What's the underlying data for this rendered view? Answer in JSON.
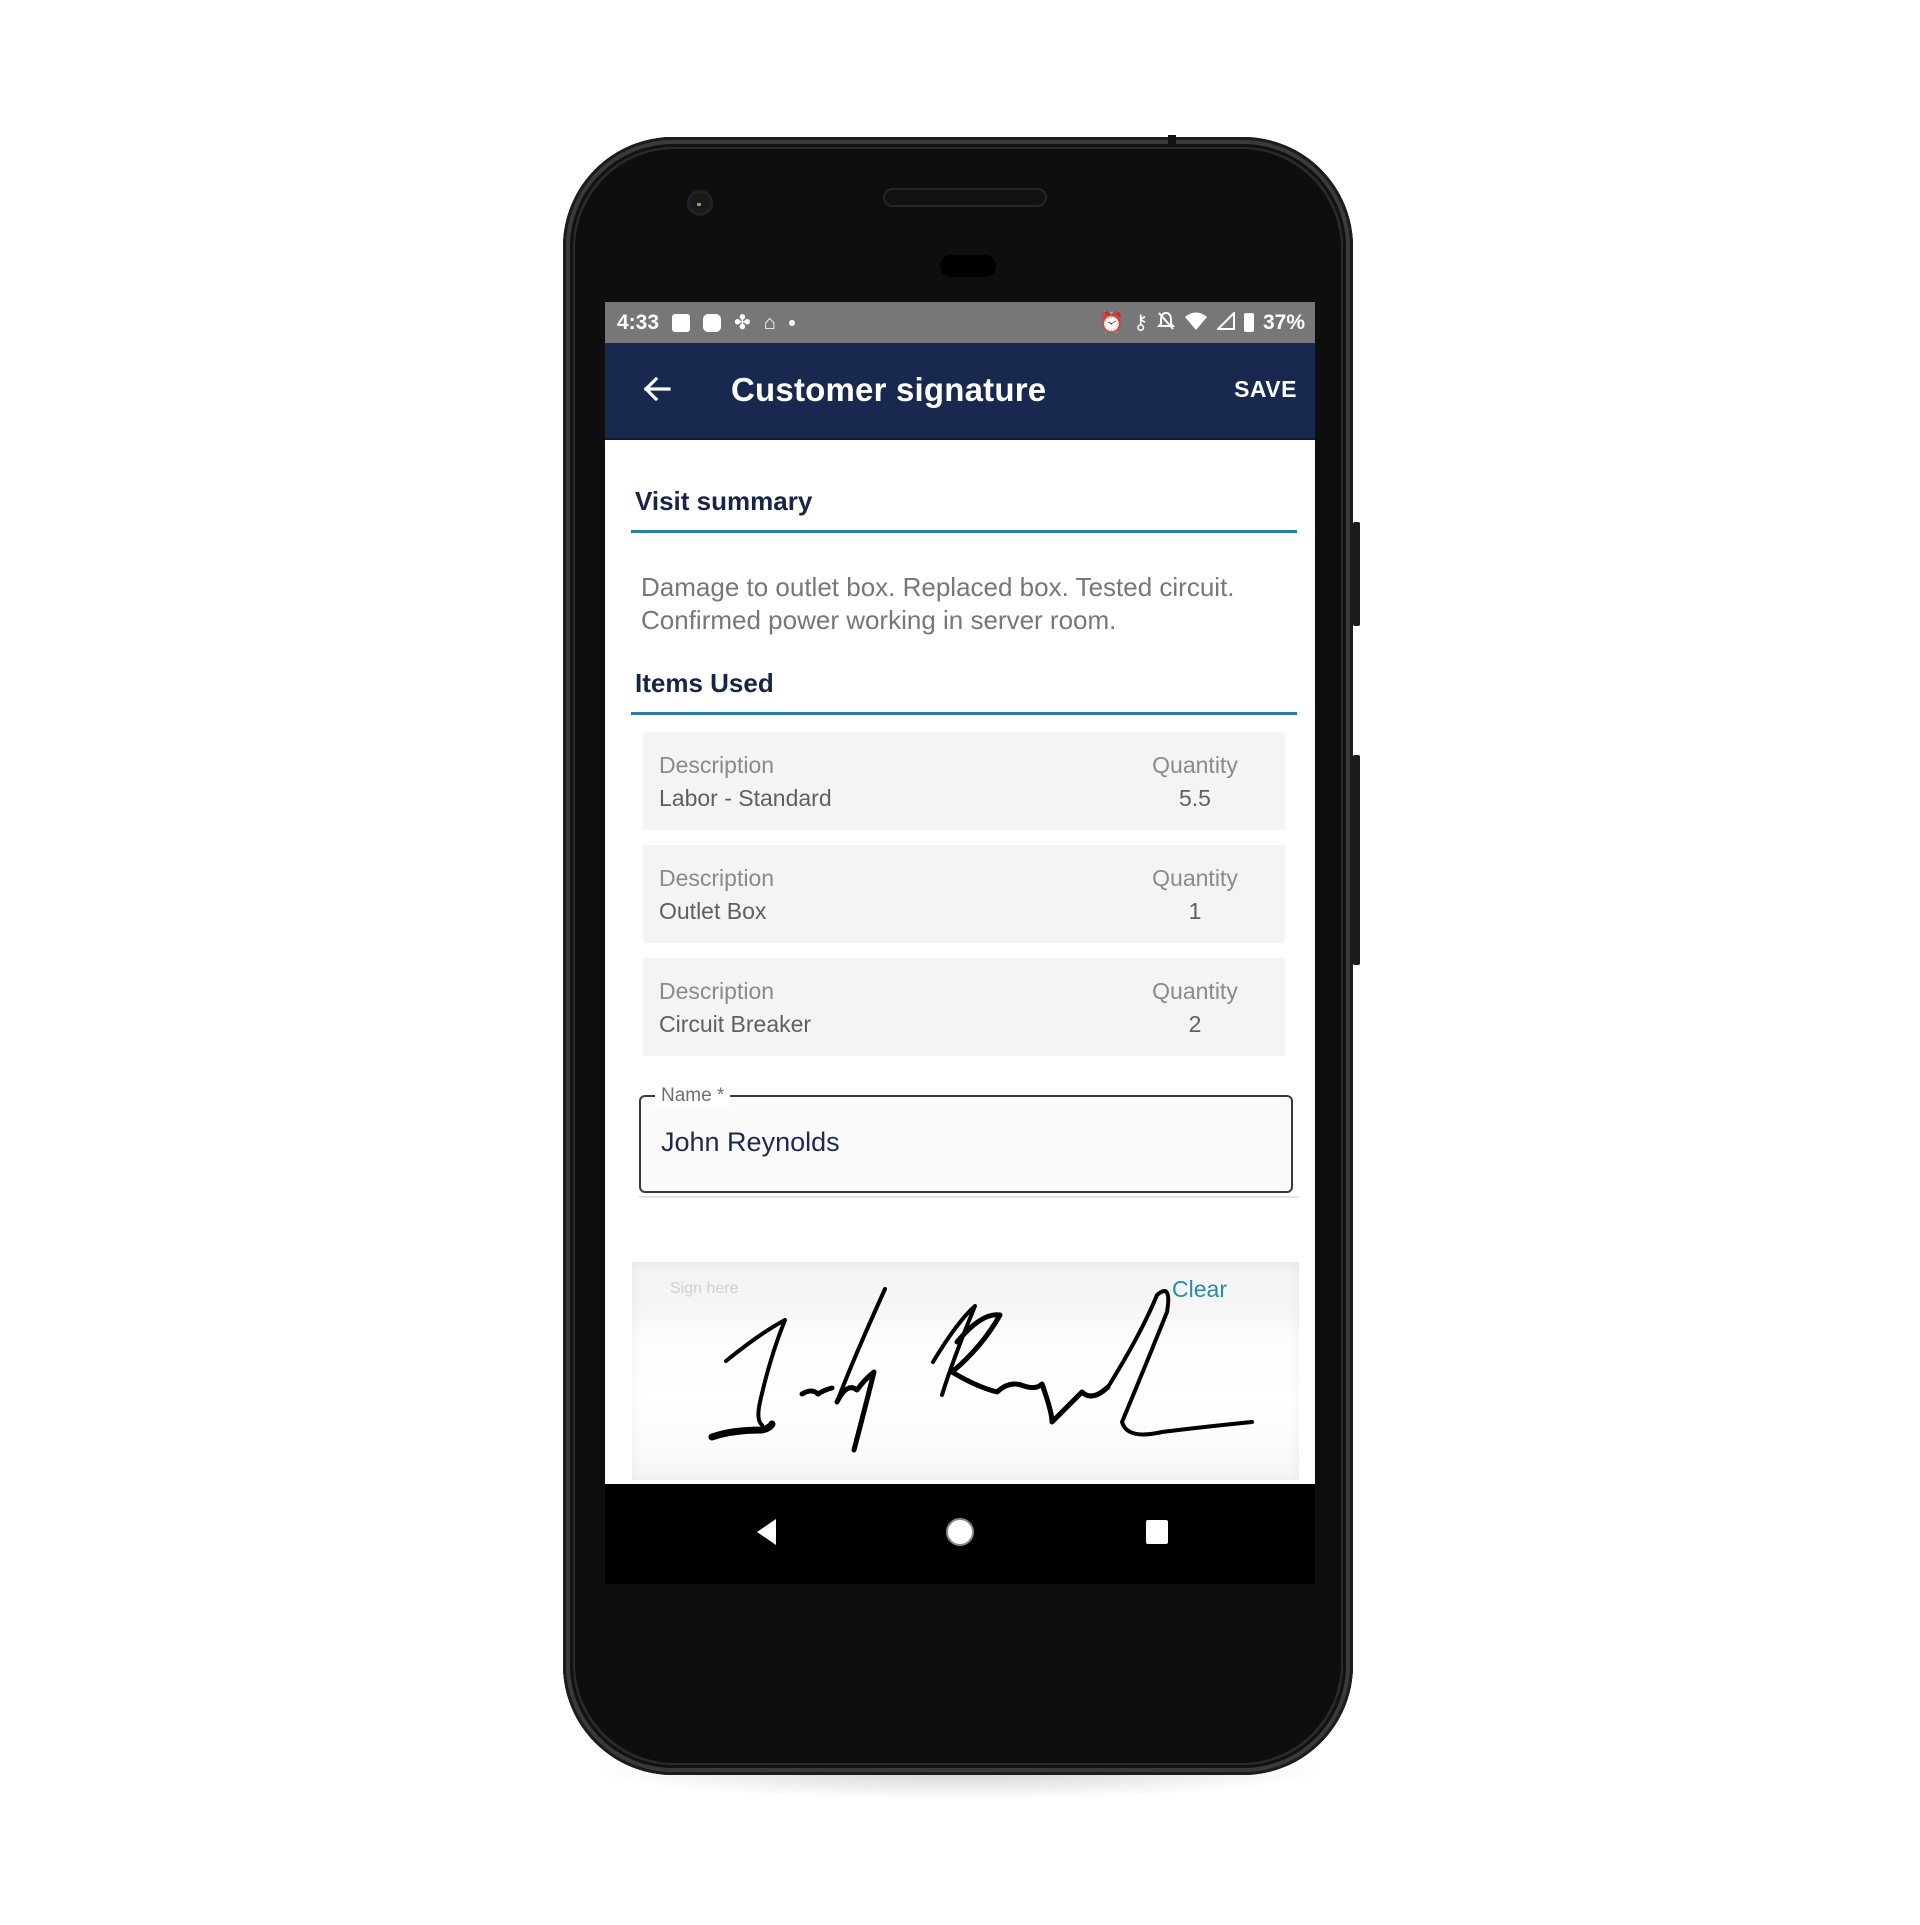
{
  "status_bar": {
    "time": "4:33",
    "left_icons": [
      "image-notification-icon",
      "message-notification-icon",
      "pinwheel-notification-icon",
      "home-notification-icon",
      "more-dot-icon"
    ],
    "right_icons": [
      "alarm-icon",
      "vpn-key-icon",
      "notifications-off-icon",
      "wifi-icon",
      "cellular-signal-icon",
      "battery-icon"
    ],
    "battery_percent": "37%"
  },
  "app_bar": {
    "back_icon": "arrow-back-icon",
    "title": "Customer signature",
    "save_label": "SAVE"
  },
  "visit_summary": {
    "heading": "Visit summary",
    "text": "Damage to outlet box. Replaced box. Tested circuit. Confirmed power working in server room."
  },
  "items_used": {
    "heading": "Items Used",
    "description_label": "Description",
    "quantity_label": "Quantity",
    "items": [
      {
        "description": "Labor - Standard",
        "quantity": "5.5"
      },
      {
        "description": "Outlet Box",
        "quantity": "1"
      },
      {
        "description": "Circuit Breaker",
        "quantity": "2"
      }
    ]
  },
  "name_field": {
    "label": "Name *",
    "value": "John Reynolds"
  },
  "signature": {
    "hint": "Sign here",
    "clear_label": "Clear",
    "has_signature": true
  },
  "nav_bar": {
    "back_icon": "nav-back-icon",
    "home_icon": "nav-home-icon",
    "recents_icon": "nav-recents-icon"
  },
  "colors": {
    "app_bar": "#18284e",
    "accent": "#2a7fa8",
    "link": "#2a8aaa",
    "status_bar": "#777777"
  }
}
